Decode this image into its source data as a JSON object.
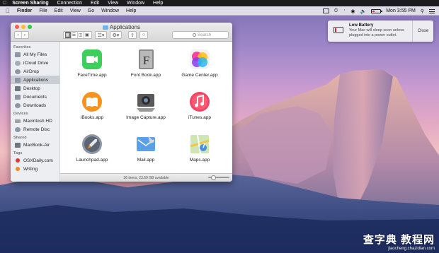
{
  "screen_sharing_bar": {
    "app_name": "Screen Sharing",
    "menus": [
      "Connection",
      "Edit",
      "View",
      "Window",
      "Help"
    ]
  },
  "menubar": {
    "app_name": "Finder",
    "menus": [
      "File",
      "Edit",
      "View",
      "Go",
      "Window",
      "Help"
    ],
    "status": {
      "clock": "Mon 3:55 PM",
      "battery_color": "#d22222"
    }
  },
  "notification": {
    "title": "Low Battery",
    "body": "Your Mac will sleep soon unless plugged into a power outlet.",
    "close_label": "Close"
  },
  "finder": {
    "title": "Applications",
    "search_placeholder": "Search",
    "sidebar": {
      "sections": [
        {
          "heading": "Favorites",
          "items": [
            {
              "label": "All My Files",
              "icon": "all-files-icon"
            },
            {
              "label": "iCloud Drive",
              "icon": "cloud-icon"
            },
            {
              "label": "AirDrop",
              "icon": "airdrop-icon"
            },
            {
              "label": "Applications",
              "icon": "applications-icon",
              "selected": true
            },
            {
              "label": "Desktop",
              "icon": "desktop-icon"
            },
            {
              "label": "Documents",
              "icon": "documents-icon"
            },
            {
              "label": "Downloads",
              "icon": "downloads-icon"
            }
          ]
        },
        {
          "heading": "Devices",
          "items": [
            {
              "label": "Macintosh HD",
              "icon": "hard-drive-icon"
            },
            {
              "label": "Remote Disc",
              "icon": "disc-icon"
            }
          ]
        },
        {
          "heading": "Shared",
          "items": [
            {
              "label": "MacBook-Air",
              "icon": "computer-icon"
            }
          ]
        },
        {
          "heading": "Tags",
          "items": [
            {
              "label": "OSXDaily.com",
              "icon": "tag-icon",
              "color": "#e0343a"
            },
            {
              "label": "Writing",
              "icon": "tag-icon",
              "color": "#f08a24"
            }
          ]
        }
      ]
    },
    "apps": [
      {
        "label": "FaceTime.app",
        "icon": "facetime-icon"
      },
      {
        "label": "Font Book.app",
        "icon": "font-book-icon"
      },
      {
        "label": "Game Center.app",
        "icon": "game-center-icon"
      },
      {
        "label": "iBooks.app",
        "icon": "ibooks-icon"
      },
      {
        "label": "Image Capture.app",
        "icon": "image-capture-icon"
      },
      {
        "label": "iTunes.app",
        "icon": "itunes-icon"
      },
      {
        "label": "Launchpad.app",
        "icon": "launchpad-icon"
      },
      {
        "label": "Mail.app",
        "icon": "mail-icon"
      },
      {
        "label": "Maps.app",
        "icon": "maps-icon"
      }
    ],
    "status_text": "36 items, 23.69 GB available"
  },
  "watermark": {
    "main": "查字典 教程网",
    "sub": "jiaocheng.chazidian.com"
  }
}
